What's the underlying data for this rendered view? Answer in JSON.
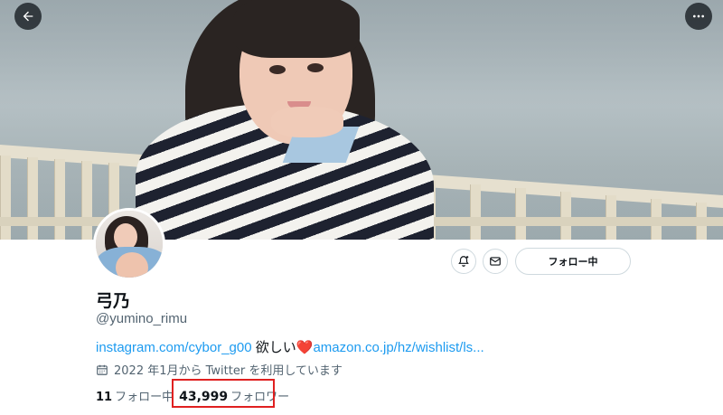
{
  "header": {
    "back_icon": "arrow-left-icon",
    "more_icon": "more-horizontal-icon"
  },
  "profile": {
    "display_name": "弓乃",
    "handle": "@yumino_rimu",
    "bio": {
      "link1": "instagram.com/cybor_g00",
      "text": " 欲しい",
      "heart": "❤️",
      "link2": "amazon.co.jp/hz/wishlist/ls..."
    },
    "joined": "2022 年1月から Twitter を利用しています",
    "following_count": "11",
    "following_label": "フォロー中",
    "followers_count": "43,999",
    "followers_label": "フォロワー"
  },
  "actions": {
    "notify_icon": "bell-plus-icon",
    "message_icon": "mail-icon",
    "follow_label": "フォロー中"
  },
  "colors": {
    "link": "#1d9bf0",
    "secondary_text": "#536471",
    "highlight_box": "#e02020"
  }
}
